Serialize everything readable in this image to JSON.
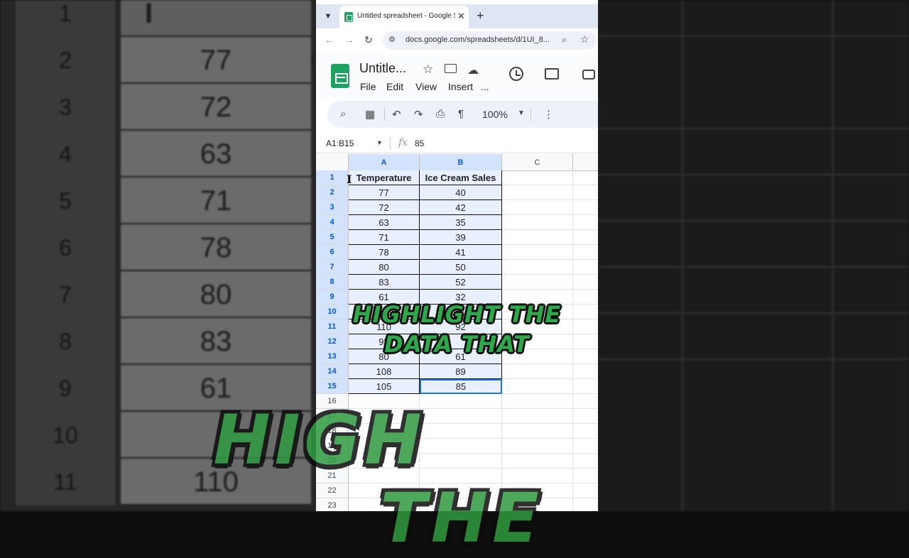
{
  "browser": {
    "tab_title": "Untitled spreadsheet - Google Sheets",
    "close_glyph": "✕",
    "new_tab_glyph": "+",
    "url": "docs.google.com/spreadsheets/d/1UI_8..."
  },
  "app": {
    "doc_title": "Untitle...",
    "menus": [
      "File",
      "Edit",
      "View",
      "Insert",
      "..."
    ]
  },
  "toolbar": {
    "zoom": "100%"
  },
  "formula_bar": {
    "name_box": "A1:B15",
    "fx": "fx",
    "value": "85"
  },
  "grid": {
    "columns": [
      "A",
      "B",
      "C"
    ],
    "header_row": [
      "Temperature",
      "Ice Cream Sales"
    ],
    "rows": [
      [
        "77",
        "40"
      ],
      [
        "72",
        "42"
      ],
      [
        "63",
        "35"
      ],
      [
        "71",
        "39"
      ],
      [
        "78",
        "41"
      ],
      [
        "80",
        "50"
      ],
      [
        "83",
        "52"
      ],
      [
        "61",
        "32"
      ],
      [
        "",
        ""
      ],
      [
        "110",
        "92"
      ],
      [
        "95",
        ""
      ],
      [
        "80",
        "61"
      ],
      [
        "108",
        "89"
      ],
      [
        "105",
        "85"
      ]
    ],
    "row_numbers": [
      "1",
      "2",
      "3",
      "4",
      "5",
      "6",
      "7",
      "8",
      "9",
      "10",
      "11",
      "12",
      "13",
      "14",
      "15",
      "16",
      "17",
      "18",
      "19",
      "20",
      "21",
      "22",
      "23"
    ]
  },
  "background": {
    "row_numbers": [
      "1",
      "2",
      "3",
      "4",
      "5",
      "6",
      "7",
      "8",
      "9",
      "10",
      "11"
    ],
    "header": "Temperature",
    "values": [
      "77",
      "72",
      "63",
      "71",
      "78",
      "80",
      "83",
      "61",
      "",
      "110"
    ]
  },
  "captions": {
    "small_line1": "HIGHLIGHT THE",
    "small_line2": "DATA THAT",
    "big_left": "HIGH",
    "big_right": "THE"
  },
  "colors": {
    "selection_fill": "#e8f0fe",
    "active_border": "#1a73e8",
    "caption_green": "#2ea84a",
    "sheets_green": "#1ea362"
  }
}
